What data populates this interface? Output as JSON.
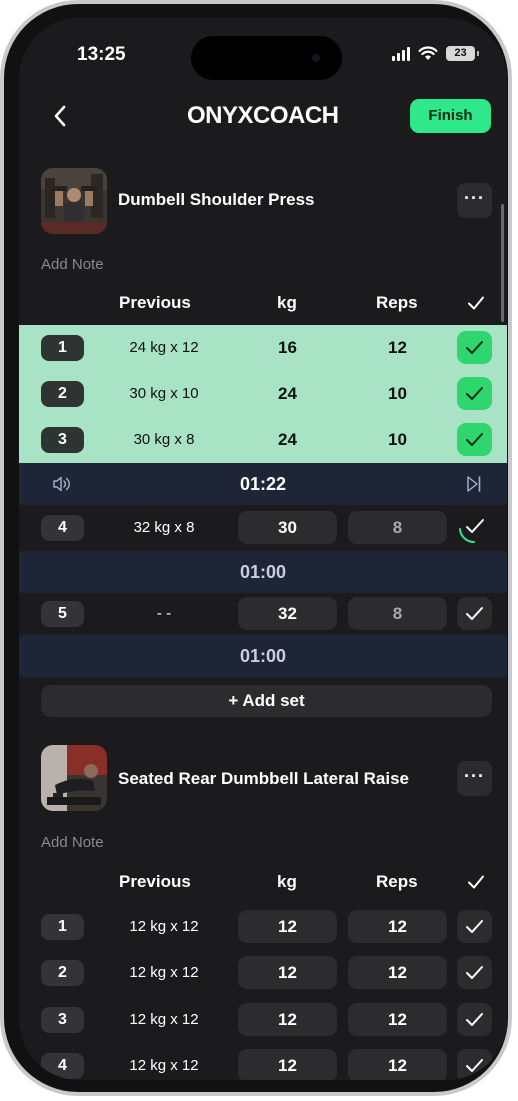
{
  "status": {
    "time": "13:25",
    "battery": "23"
  },
  "header": {
    "logo": "ONYXCOACH",
    "finish_label": "Finish",
    "back_icon": "chevron-left-icon"
  },
  "colors": {
    "accent": "#2ee88a",
    "done_row": "#a8e3c5",
    "check_done": "#2fd66e",
    "rest_bar": "#1d2536",
    "screen_bg": "#1b1b1d"
  },
  "columns": {
    "previous": "Previous",
    "kg": "kg",
    "reps": "Reps"
  },
  "exercise1": {
    "title": "Dumbell Shoulder Press",
    "more_label": "···",
    "add_note": "Add Note",
    "sets": [
      {
        "num": "1",
        "previous": "24 kg x 12",
        "kg": "16",
        "reps": "12",
        "completed": true
      },
      {
        "num": "2",
        "previous": "30 kg x 10",
        "kg": "24",
        "reps": "10",
        "completed": true
      },
      {
        "num": "3",
        "previous": "30 kg x 8",
        "kg": "24",
        "reps": "10",
        "completed": true
      },
      {
        "num": "4",
        "previous": "32 kg x 8",
        "kg": "30",
        "reps": "8",
        "completed": false
      },
      {
        "num": "5",
        "previous": "- -",
        "kg": "32",
        "reps": "8",
        "completed": false
      }
    ],
    "rest_active": "01:22",
    "rest_after_4": "01:00",
    "rest_after_5": "01:00",
    "add_set": "+ Add set"
  },
  "exercise2": {
    "title": "Seated Rear Dumbbell Lateral Raise",
    "more_label": "···",
    "add_note": "Add Note",
    "sets": [
      {
        "num": "1",
        "previous": "12 kg x 12",
        "kg": "12",
        "reps": "12",
        "completed": false
      },
      {
        "num": "2",
        "previous": "12 kg x 12",
        "kg": "12",
        "reps": "12",
        "completed": false
      },
      {
        "num": "3",
        "previous": "12 kg x 12",
        "kg": "12",
        "reps": "12",
        "completed": false
      },
      {
        "num": "4",
        "previous": "12 kg x 12",
        "kg": "12",
        "reps": "12",
        "completed": false
      }
    ]
  }
}
